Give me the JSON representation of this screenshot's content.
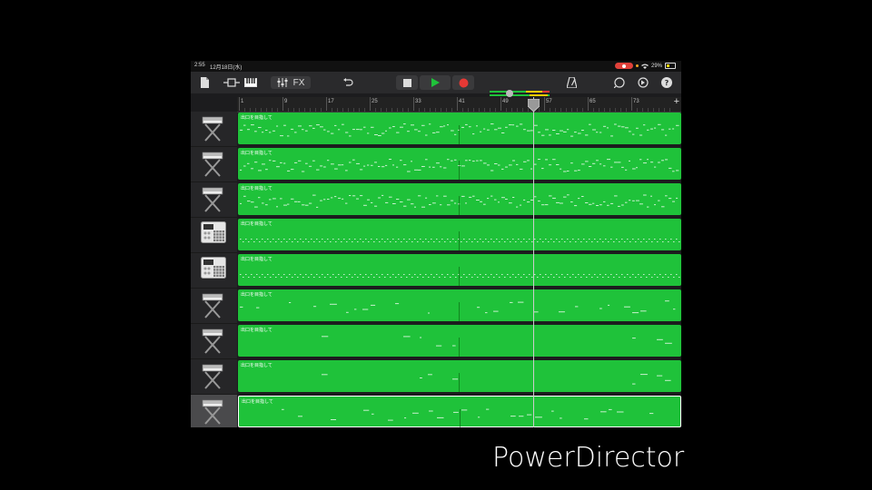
{
  "status": {
    "time": "2:55",
    "date": "12月18日(水)",
    "battery": "29%"
  },
  "toolbar": {
    "fx_label": "FX",
    "playing": true,
    "accent": "#1fc23a",
    "record_color": "#e53935"
  },
  "ruler": {
    "bars": [
      "1",
      "9",
      "17",
      "25",
      "33",
      "41",
      "49",
      "57",
      "65",
      "73"
    ],
    "add_label": "+"
  },
  "playhead": {
    "bar": 55
  },
  "tracks": [
    {
      "instrument_icon": "keyboard-icon",
      "region_label": "出口を目指して",
      "selected": false
    },
    {
      "instrument_icon": "keyboard-icon",
      "region_label": "出口を目指して",
      "selected": false
    },
    {
      "instrument_icon": "keyboard-icon",
      "region_label": "出口を目指して",
      "selected": false
    },
    {
      "instrument_icon": "drum-machine-icon",
      "region_label": "出口を目指して",
      "selected": false
    },
    {
      "instrument_icon": "drum-machine-icon",
      "region_label": "出口を目指して",
      "selected": false
    },
    {
      "instrument_icon": "keyboard-icon",
      "region_label": "出口を目指して",
      "selected": false
    },
    {
      "instrument_icon": "keyboard-icon",
      "region_label": "出口を目指して",
      "selected": false
    },
    {
      "instrument_icon": "keyboard-icon",
      "region_label": "出口を目指して",
      "selected": false
    },
    {
      "instrument_icon": "keyboard-icon",
      "region_label": "出口を目指して",
      "selected": true
    }
  ],
  "watermark": "PowerDirector"
}
